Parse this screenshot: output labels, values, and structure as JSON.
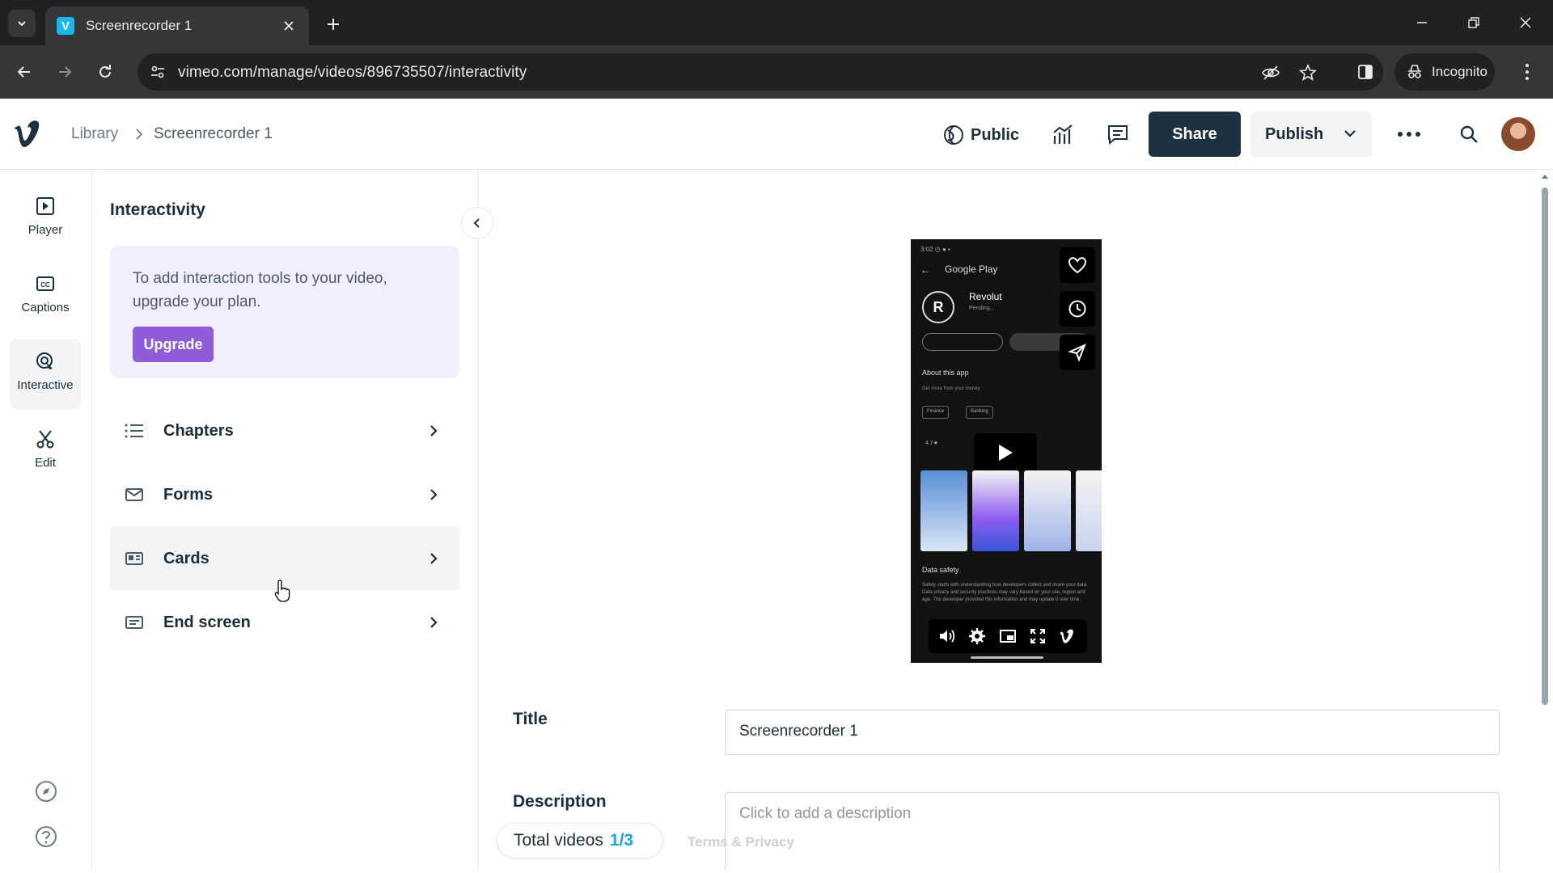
{
  "browser": {
    "tab_title": "Screenrecorder 1",
    "tab_favicon_letter": "V",
    "url": "vimeo.com/manage/videos/896735507/interactivity",
    "incognito_label": "Incognito"
  },
  "header": {
    "breadcrumb_library": "Library",
    "breadcrumb_current": "Screenrecorder 1",
    "privacy_label": "Public",
    "share_label": "Share",
    "publish_label": "Publish"
  },
  "rail": {
    "items": [
      {
        "label": "Player",
        "icon": "play-square-icon"
      },
      {
        "label": "Captions",
        "icon": "cc-icon"
      },
      {
        "label": "Interactive",
        "icon": "cursor-click-icon",
        "active": true
      },
      {
        "label": "Edit",
        "icon": "scissors-icon"
      }
    ]
  },
  "panel": {
    "title": "Interactivity",
    "upgrade_text": "To add interaction tools to your video, upgrade your plan.",
    "upgrade_button": "Upgrade",
    "menu": [
      {
        "label": "Chapters",
        "icon": "list-icon"
      },
      {
        "label": "Forms",
        "icon": "mail-icon"
      },
      {
        "label": "Cards",
        "icon": "card-icon"
      },
      {
        "label": "End screen",
        "icon": "end-screen-icon"
      }
    ]
  },
  "video_preview": {
    "store_label": "Google Play",
    "app_name": "Revolut",
    "app_icon_letter": "R",
    "app_status": "Pending...",
    "about_label": "About this app",
    "about_sub": "Get more from your money",
    "chips": [
      "Finance",
      "Banking"
    ],
    "stats": "4.7★",
    "data_safety_label": "Data safety",
    "data_safety_text": "Safety starts with understanding how developers collect and share your data. Data privacy and security practices may vary based on your use, region and age. The developer provided this information and may update it over time."
  },
  "form": {
    "title_label": "Title",
    "title_value": "Screenrecorder 1",
    "description_label": "Description",
    "description_placeholder": "Click to add a description"
  },
  "footer": {
    "total_label": "Total videos",
    "total_count": "1/3",
    "terms": "Terms & Privacy"
  },
  "colors": {
    "brand_dark": "#1d3140",
    "upgrade_purple": "#8f5bd6",
    "upgrade_bg": "#f2eefe",
    "accent_blue": "#17a5e6"
  }
}
